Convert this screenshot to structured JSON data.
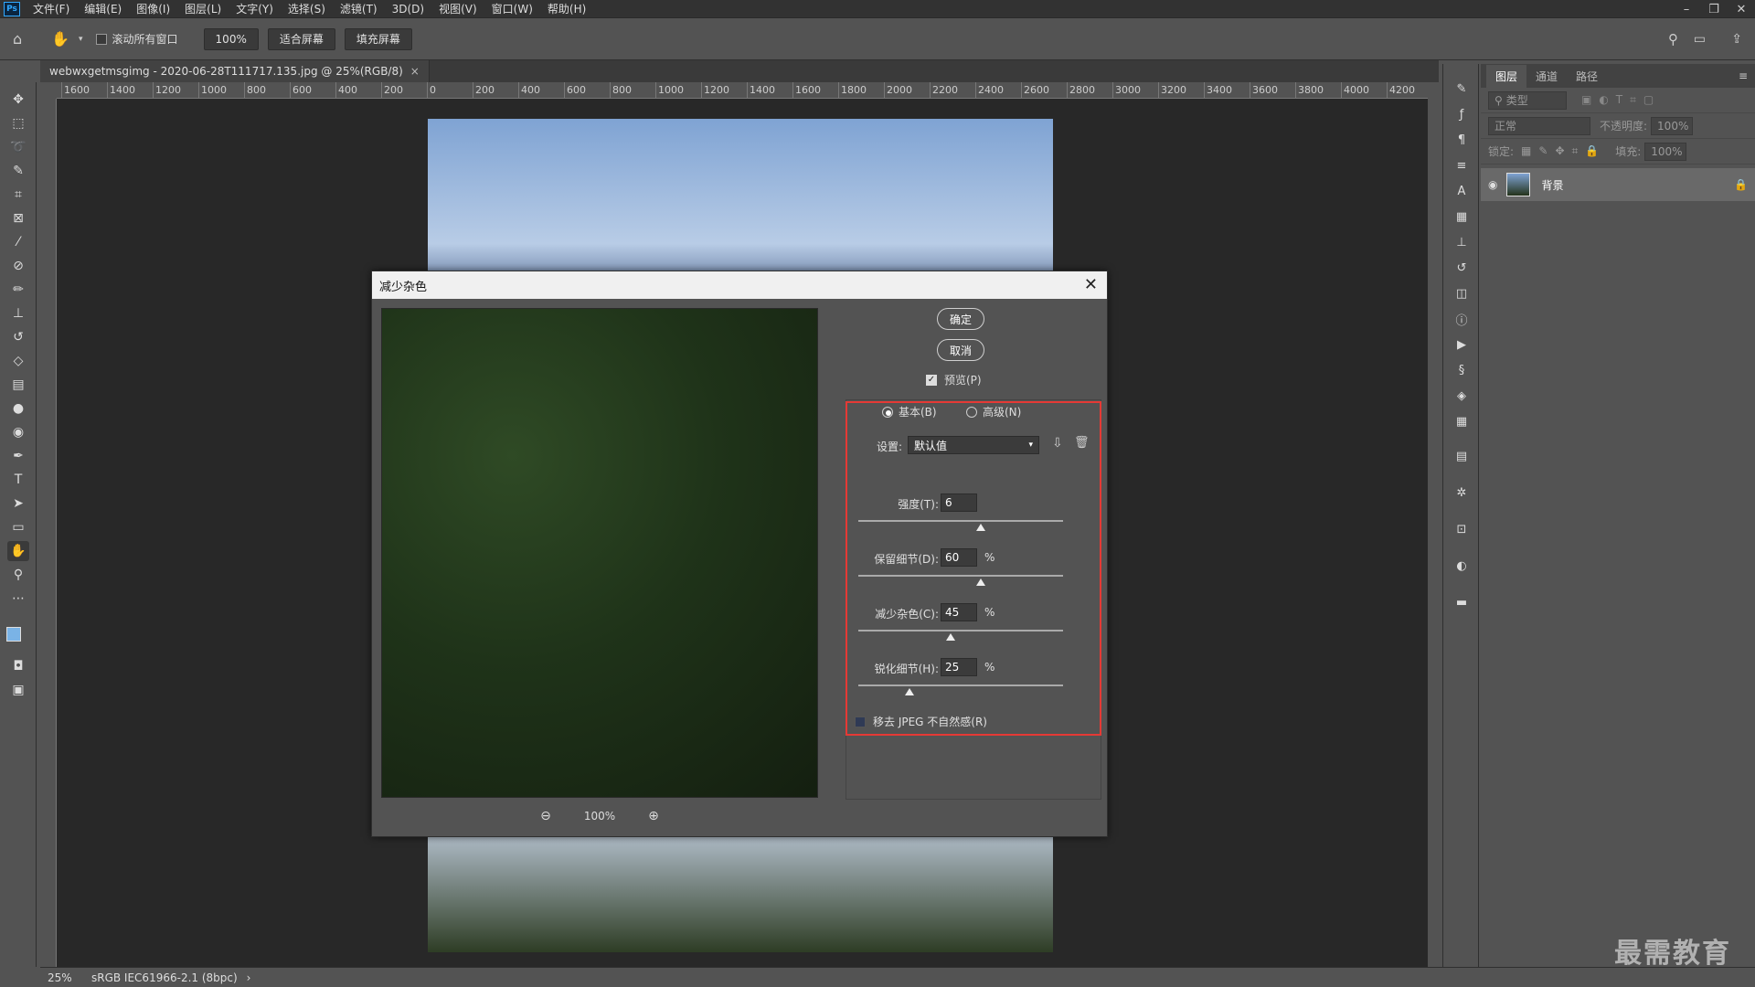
{
  "menu": {
    "logo": "Ps",
    "items": [
      "文件(F)",
      "编辑(E)",
      "图像(I)",
      "图层(L)",
      "文字(Y)",
      "选择(S)",
      "滤镜(T)",
      "3D(D)",
      "视图(V)",
      "窗口(W)",
      "帮助(H)"
    ]
  },
  "window_controls": {
    "minimize": "–",
    "restore": "❐",
    "close": "✕"
  },
  "options": {
    "scroll_all_label": "滚动所有窗口",
    "zoom_value": "100%",
    "fit_screen": "适合屏幕",
    "fill_screen": "填充屏幕"
  },
  "document": {
    "tab_title": "webwxgetmsgimg - 2020-06-28T111717.135.jpg @ 25%(RGB/8)",
    "tab_close": "×"
  },
  "ruler": {
    "labels": [
      "1600",
      "1400",
      "1200",
      "1000",
      "800",
      "600",
      "400",
      "200",
      "0",
      "200",
      "400",
      "600",
      "800",
      "1000",
      "1200",
      "1400",
      "1600",
      "1800",
      "2000",
      "2200",
      "2400",
      "2600",
      "2800",
      "3000",
      "3200",
      "3400",
      "3600",
      "3800",
      "4000",
      "4200"
    ]
  },
  "layers_panel": {
    "tabs": [
      "图层",
      "通道",
      "路径"
    ],
    "filter_label": "类型",
    "blend_mode": "正常",
    "opacity_label": "不透明度:",
    "opacity_value": "100%",
    "lock_label": "锁定:",
    "fill_label": "填充:",
    "fill_value": "100%",
    "layer_name": "背景"
  },
  "status": {
    "zoom": "25%",
    "profile": "sRGB IEC61966-2.1 (8bpc)",
    "arrow": "›"
  },
  "watermark": "最需教育",
  "dialog": {
    "title": "减少杂色",
    "ok": "确定",
    "cancel": "取消",
    "preview_label": "预览(P)",
    "preview_checked": true,
    "mode_basic": "基本(B)",
    "mode_advanced": "高级(N)",
    "mode_selected": "basic",
    "settings_label": "设置:",
    "settings_value": "默认值",
    "zoom_value": "100%",
    "sliders": [
      {
        "label": "强度(T):",
        "value": "6",
        "unit": "",
        "fraction": 0.6
      },
      {
        "label": "保留细节(D):",
        "value": "60",
        "unit": "%",
        "fraction": 0.6
      },
      {
        "label": "减少杂色(C):",
        "value": "45",
        "unit": "%",
        "fraction": 0.45
      },
      {
        "label": "锐化细节(H):",
        "value": "25",
        "unit": "%",
        "fraction": 0.25
      }
    ],
    "jpeg_label": "移去 JPEG 不自然感(R)",
    "jpeg_checked": false
  }
}
